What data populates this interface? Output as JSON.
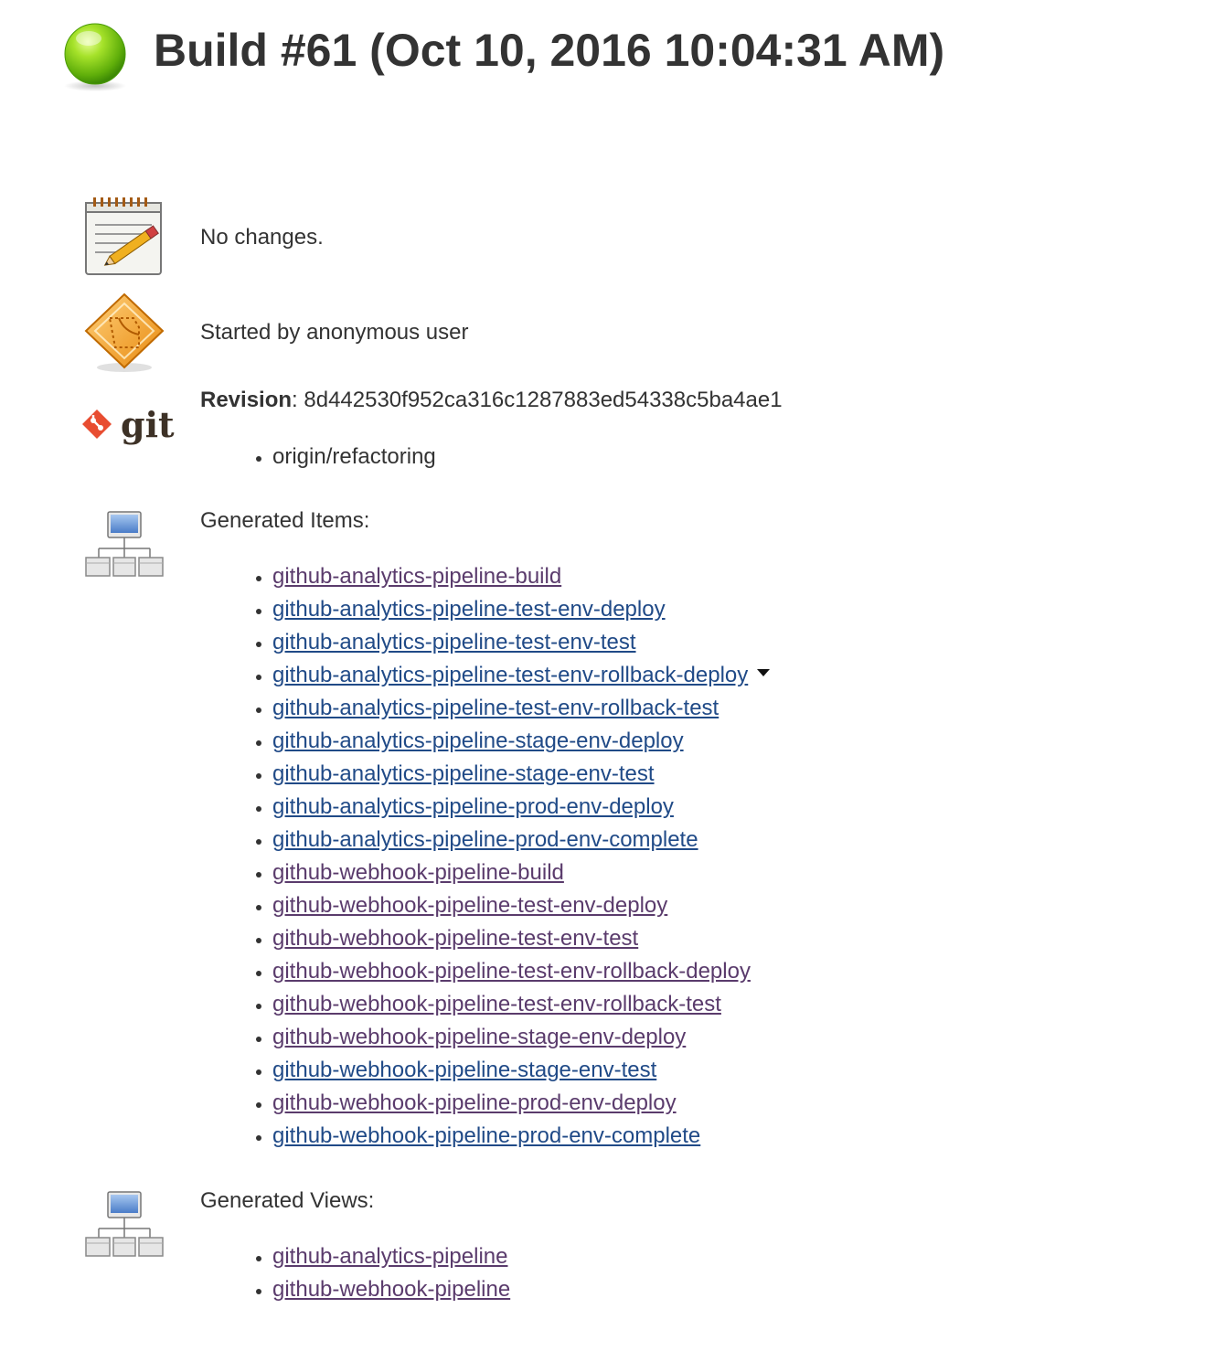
{
  "header": {
    "status_icon": "blue-ball-success-icon",
    "status_color": "#7fcc1b",
    "title": "Build #61 (Oct 10, 2016 10:04:31 AM)"
  },
  "changes": {
    "icon": "notepad-pencil-icon",
    "text": "No changes."
  },
  "cause": {
    "icon": "orange-diamond-user-icon",
    "text": "Started by anonymous user"
  },
  "git": {
    "icon": "git-logo",
    "logo_text": "git",
    "revision_label": "Revision",
    "revision_sep": ": ",
    "revision_value": "8d442530f952ca316c1287883ed54338c5ba4ae1",
    "branches": [
      "origin/refactoring"
    ]
  },
  "generated_items": {
    "icon": "hierarchy-icon",
    "label": "Generated Items:",
    "items": [
      {
        "name": "github-analytics-pipeline-build",
        "visited": true
      },
      {
        "name": "github-analytics-pipeline-test-env-deploy",
        "visited": false
      },
      {
        "name": "github-analytics-pipeline-test-env-test",
        "visited": false
      },
      {
        "name": "github-analytics-pipeline-test-env-rollback-deploy",
        "visited": false,
        "menu": true
      },
      {
        "name": "github-analytics-pipeline-test-env-rollback-test",
        "visited": false
      },
      {
        "name": "github-analytics-pipeline-stage-env-deploy",
        "visited": false
      },
      {
        "name": "github-analytics-pipeline-stage-env-test",
        "visited": false
      },
      {
        "name": "github-analytics-pipeline-prod-env-deploy",
        "visited": false
      },
      {
        "name": "github-analytics-pipeline-prod-env-complete",
        "visited": false
      },
      {
        "name": "github-webhook-pipeline-build",
        "visited": true
      },
      {
        "name": "github-webhook-pipeline-test-env-deploy",
        "visited": true
      },
      {
        "name": "github-webhook-pipeline-test-env-test",
        "visited": true
      },
      {
        "name": "github-webhook-pipeline-test-env-rollback-deploy",
        "visited": true
      },
      {
        "name": "github-webhook-pipeline-test-env-rollback-test",
        "visited": true
      },
      {
        "name": "github-webhook-pipeline-stage-env-deploy",
        "visited": true
      },
      {
        "name": "github-webhook-pipeline-stage-env-test",
        "visited": false
      },
      {
        "name": "github-webhook-pipeline-prod-env-deploy",
        "visited": true
      },
      {
        "name": "github-webhook-pipeline-prod-env-complete",
        "visited": false
      }
    ]
  },
  "generated_views": {
    "icon": "hierarchy-icon",
    "label": "Generated Views:",
    "items": [
      {
        "name": "github-analytics-pipeline",
        "visited": true
      },
      {
        "name": "github-webhook-pipeline",
        "visited": true
      }
    ]
  },
  "colors": {
    "visited_link": "#5a3b6c",
    "unvisited_link": "#204a87",
    "text": "#333333"
  }
}
